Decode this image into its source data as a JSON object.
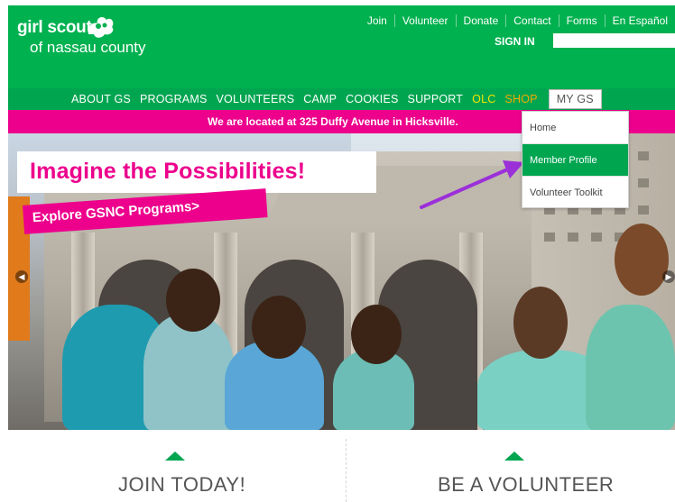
{
  "header": {
    "logo_line1": "girl scouts",
    "logo_line2": "of nassau county",
    "top_links": [
      "Join",
      "Volunteer",
      "Donate",
      "Contact",
      "Forms",
      "En Español"
    ],
    "signin_label": "SIGN IN",
    "search_value": ""
  },
  "nav": {
    "items": [
      "ABOUT GS",
      "PROGRAMS",
      "VOLUNTEERS",
      "CAMP",
      "COOKIES",
      "SUPPORT",
      "OLC",
      "SHOP",
      "MY GS"
    ]
  },
  "location_banner": "We are located at 325 Duffy Avenue in Hicksville.",
  "hero": {
    "headline": "Imagine the Possibilities!",
    "cta": "Explore GSNC Programs>"
  },
  "dropdown": {
    "items": [
      "Home",
      "Member Profile",
      "Volunteer Toolkit"
    ],
    "active_index": 1
  },
  "bottom": {
    "left_cta": "JOIN TODAY!",
    "right_cta": "BE A VOLUNTEER"
  },
  "colors": {
    "brand_green": "#00b14f",
    "nav_green": "#00a550",
    "magenta": "#ec008c",
    "olc_yellow": "#f2e600",
    "shop_orange": "#f2a900",
    "arrow_purple": "#9b30d9"
  }
}
